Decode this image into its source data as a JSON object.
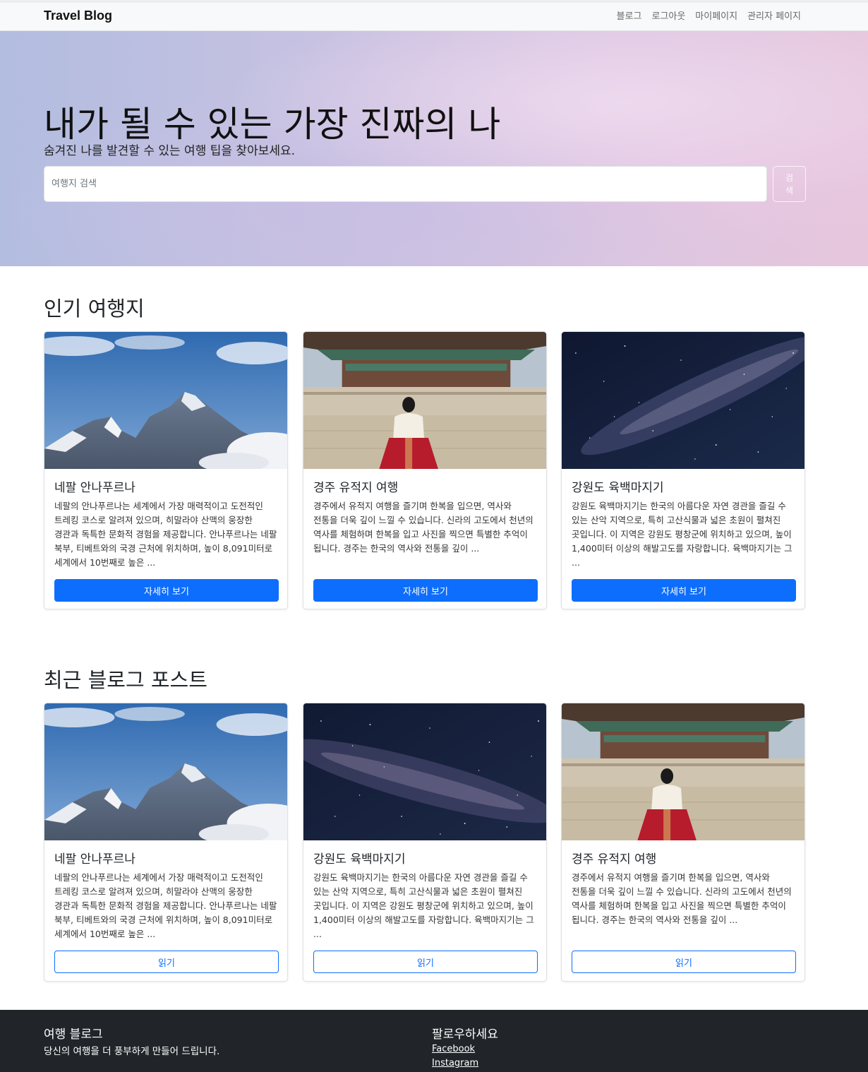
{
  "nav": {
    "brand": "Travel Blog",
    "links": [
      "블로그",
      "로그아웃",
      "마이페이지",
      "관리자 페이지"
    ]
  },
  "hero": {
    "title": "내가 될 수 있는 가장 진짜의 나",
    "subtitle": "숨겨진 나를 발견할 수 있는 여행 팁을 찾아보세요.",
    "search_placeholder": "여행지 검색",
    "search_button": "검색"
  },
  "popular": {
    "title": "인기 여행지",
    "cards": [
      {
        "image": "mountain-image",
        "title": "네팔 안나푸르나",
        "text": "네팔의 안나푸르나는 세계에서 가장 매력적이고 도전적인 트레킹 코스로 알려져 있으며, 히말라야 산맥의 웅장한 경관과 독특한 문화적 경험을 제공합니다. 안나푸르나는 네팔 북부, 티베트와의 국경 근처에 위치하며, 높이 8,091미터로 세계에서 10번째로 높은 ...",
        "button": "자세히 보기"
      },
      {
        "image": "palace-image",
        "title": "경주 유적지 여행",
        "text": "경주에서 유적지 여행을 즐기며 한복을 입으면, 역사와 전통을 더욱 깊이 느낄 수 있습니다. 신라의 고도에서 천년의 역사를 체험하며 한복을 입고 사진을 찍으면 특별한 추억이 됩니다. 경주는 한국의 역사와 전통을 깊이 ...",
        "button": "자세히 보기"
      },
      {
        "image": "night-sky-image",
        "title": "강원도 육백마지기",
        "text": "강원도 육백마지기는 한국의 아름다운 자연 경관을 즐길 수 있는 산악 지역으로, 특히 고산식물과 넓은 초원이 펼쳐진 곳입니다. 이 지역은 강원도 평창군에 위치하고 있으며, 높이 1,400미터 이상의 해발고도를 자랑합니다. 육백마지기는 그 ...",
        "button": "자세히 보기"
      }
    ]
  },
  "recent": {
    "title": "최근 블로그 포스트",
    "cards": [
      {
        "image": "mountain-image",
        "title": "네팔 안나푸르나",
        "text": "네팔의 안나푸르나는 세계에서 가장 매력적이고 도전적인 트레킹 코스로 알려져 있으며, 히말라야 산맥의 웅장한 경관과 독특한 문화적 경험을 제공합니다. 안나푸르나는 네팔 북부, 티베트와의 국경 근처에 위치하며, 높이 8,091미터로 세계에서 10번째로 높은 ...",
        "button": "읽기"
      },
      {
        "image": "night-sky-image",
        "title": "강원도 육백마지기",
        "text": "강원도 육백마지기는 한국의 아름다운 자연 경관을 즐길 수 있는 산악 지역으로, 특히 고산식물과 넓은 초원이 펼쳐진 곳입니다. 이 지역은 강원도 평창군에 위치하고 있으며, 높이 1,400미터 이상의 해발고도를 자랑합니다. 육백마지기는 그 ...",
        "button": "읽기"
      },
      {
        "image": "palace-image",
        "title": "경주 유적지 여행",
        "text": "경주에서 유적지 여행을 즐기며 한복을 입으면, 역사와 전통을 더욱 깊이 느낄 수 있습니다. 신라의 고도에서 천년의 역사를 체험하며 한복을 입고 사진을 찍으면 특별한 추억이 됩니다. 경주는 한국의 역사와 전통을 깊이 ...",
        "button": "읽기"
      }
    ]
  },
  "footer": {
    "title": "여행 블로그",
    "text": "당신의 여행을 더 풍부하게 만들어 드립니다.",
    "follow_title": "팔로우하세요",
    "links": [
      "Facebook",
      "Instagram"
    ]
  },
  "colors": {
    "primary": "#0d6efd",
    "footer_bg": "#212529",
    "navbar_bg": "#f8f9fa"
  }
}
